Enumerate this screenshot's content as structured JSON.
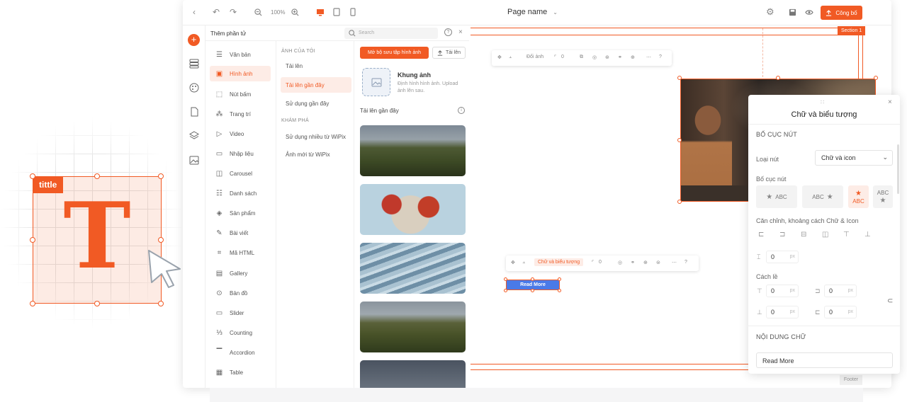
{
  "decor": {
    "tag_label": "tittle",
    "big_letter": "T"
  },
  "topbar": {
    "zoom": "100%",
    "page_name": "Page name",
    "publish": "Công bố"
  },
  "add_panel": {
    "title": "Thêm phần tử",
    "search_placeholder": "Search",
    "categories": [
      {
        "label": "Văn bản",
        "icon": "text-icon"
      },
      {
        "label": "Hình ảnh",
        "icon": "image-icon"
      },
      {
        "label": "Nút bấm",
        "icon": "button-icon"
      },
      {
        "label": "Trang trí",
        "icon": "decor-icon"
      },
      {
        "label": "Video",
        "icon": "video-icon"
      },
      {
        "label": "Nhập liệu",
        "icon": "input-icon"
      },
      {
        "label": "Carousel",
        "icon": "carousel-icon"
      },
      {
        "label": "Danh sách",
        "icon": "list-icon"
      },
      {
        "label": "Sản phẩm",
        "icon": "product-icon"
      },
      {
        "label": "Bài viết",
        "icon": "post-icon"
      },
      {
        "label": "Mã HTML",
        "icon": "html-icon"
      },
      {
        "label": "Gallery",
        "icon": "gallery-icon"
      },
      {
        "label": "Bản đồ",
        "icon": "map-icon"
      },
      {
        "label": "Slider",
        "icon": "slider-icon"
      },
      {
        "label": "Counting",
        "icon": "counting-icon"
      },
      {
        "label": "Accordion",
        "icon": "accordion-icon"
      },
      {
        "label": "Table",
        "icon": "table-icon"
      }
    ],
    "my_images_heading": "ẢNH CỦA TÔI",
    "my_images": [
      "Tải lên",
      "Tải lên gần đây",
      "Sử dụng gần đây"
    ],
    "explore_heading": "KHÁM PHÁ",
    "explore": [
      "Sử dụng nhiều từ WiPix",
      "Ảnh mới từ WiPix"
    ],
    "open_collection": "Mở bộ sưu tập hình ảnh",
    "upload": "Tải lên",
    "frame_title": "Khung ảnh",
    "frame_desc": "Định hình hình ảnh. Upload ảnh lên sau.",
    "recent_heading": "Tải lên gần đây"
  },
  "canvas": {
    "section_label": "Section 1",
    "footer_label": "Footer",
    "image_toolbar": {
      "change": "Đổi ảnh",
      "radius": "0"
    },
    "button_toolbar": {
      "mode": "Chữ và biểu tượng",
      "radius": "0"
    },
    "button_text": "Read More"
  },
  "right_panel": {
    "title": "Chữ và biểu tượng",
    "layout_heading": "BỐ CỤC NÚT",
    "button_type_label": "Loại nút",
    "button_type_value": "Chữ và icon",
    "layout_label": "Bố cục nút",
    "layout_options": [
      "ABC",
      "ABC",
      "ABC",
      "ABC"
    ],
    "align_label": "Căn chỉnh, khoảng cách Chữ & Icon",
    "gap": {
      "value": "0",
      "unit": "px"
    },
    "padding_label": "Cách lề",
    "paddings": [
      {
        "value": "0",
        "unit": "px"
      },
      {
        "value": "0",
        "unit": "px"
      },
      {
        "value": "0",
        "unit": "px"
      },
      {
        "value": "0",
        "unit": "px"
      }
    ],
    "content_heading": "NỘI DUNG CHỮ",
    "content_value": "Read More"
  }
}
